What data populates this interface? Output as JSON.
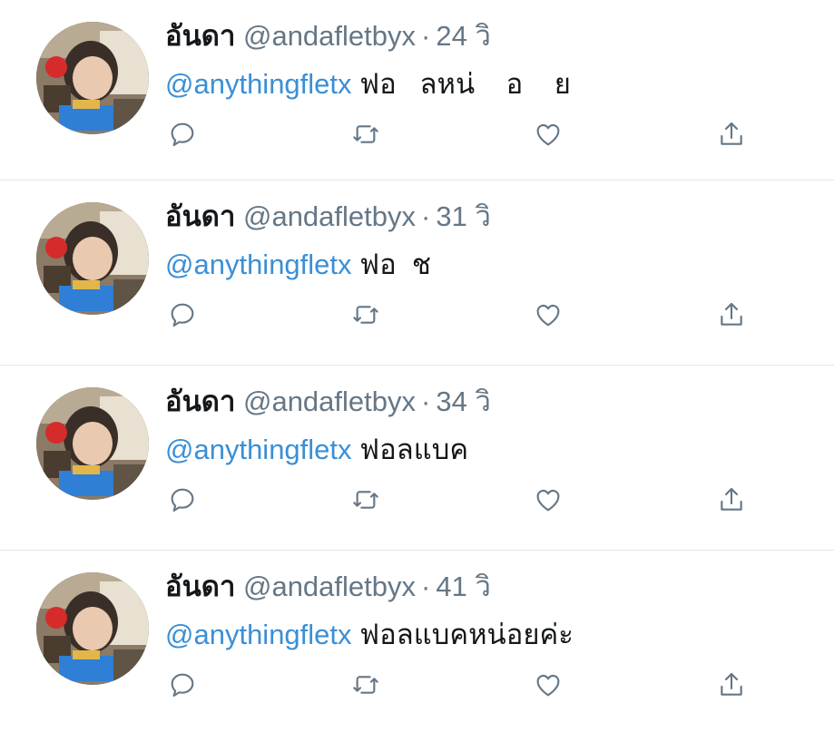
{
  "tweets": [
    {
      "display_name": "อันดา",
      "handle": "@andafletbyx",
      "separator": "·",
      "time": "24 วิ",
      "mention": "@anythingfletx",
      "text": " ฟอ   ลหน่    อ    ย"
    },
    {
      "display_name": "อันดา",
      "handle": "@andafletbyx",
      "separator": "·",
      "time": "31 วิ",
      "mention": "@anythingfletx",
      "text": " ฟอ  ช"
    },
    {
      "display_name": "อันดา",
      "handle": "@andafletbyx",
      "separator": "·",
      "time": "34 วิ",
      "mention": "@anythingfletx",
      "text": " ฟอลแบค"
    },
    {
      "display_name": "อันดา",
      "handle": "@andafletbyx",
      "separator": "·",
      "time": "41 วิ",
      "mention": "@anythingfletx",
      "text": " ฟอลแบคหน่อยค่ะ"
    }
  ],
  "icons": {
    "reply": "reply-icon",
    "retweet": "retweet-icon",
    "like": "heart-icon",
    "share": "share-icon"
  },
  "colors": {
    "mention": "#3b8fd6",
    "secondary_text": "#657786",
    "primary_text": "#14171a",
    "divider": "#e1e6ea",
    "icon": "#657786"
  }
}
